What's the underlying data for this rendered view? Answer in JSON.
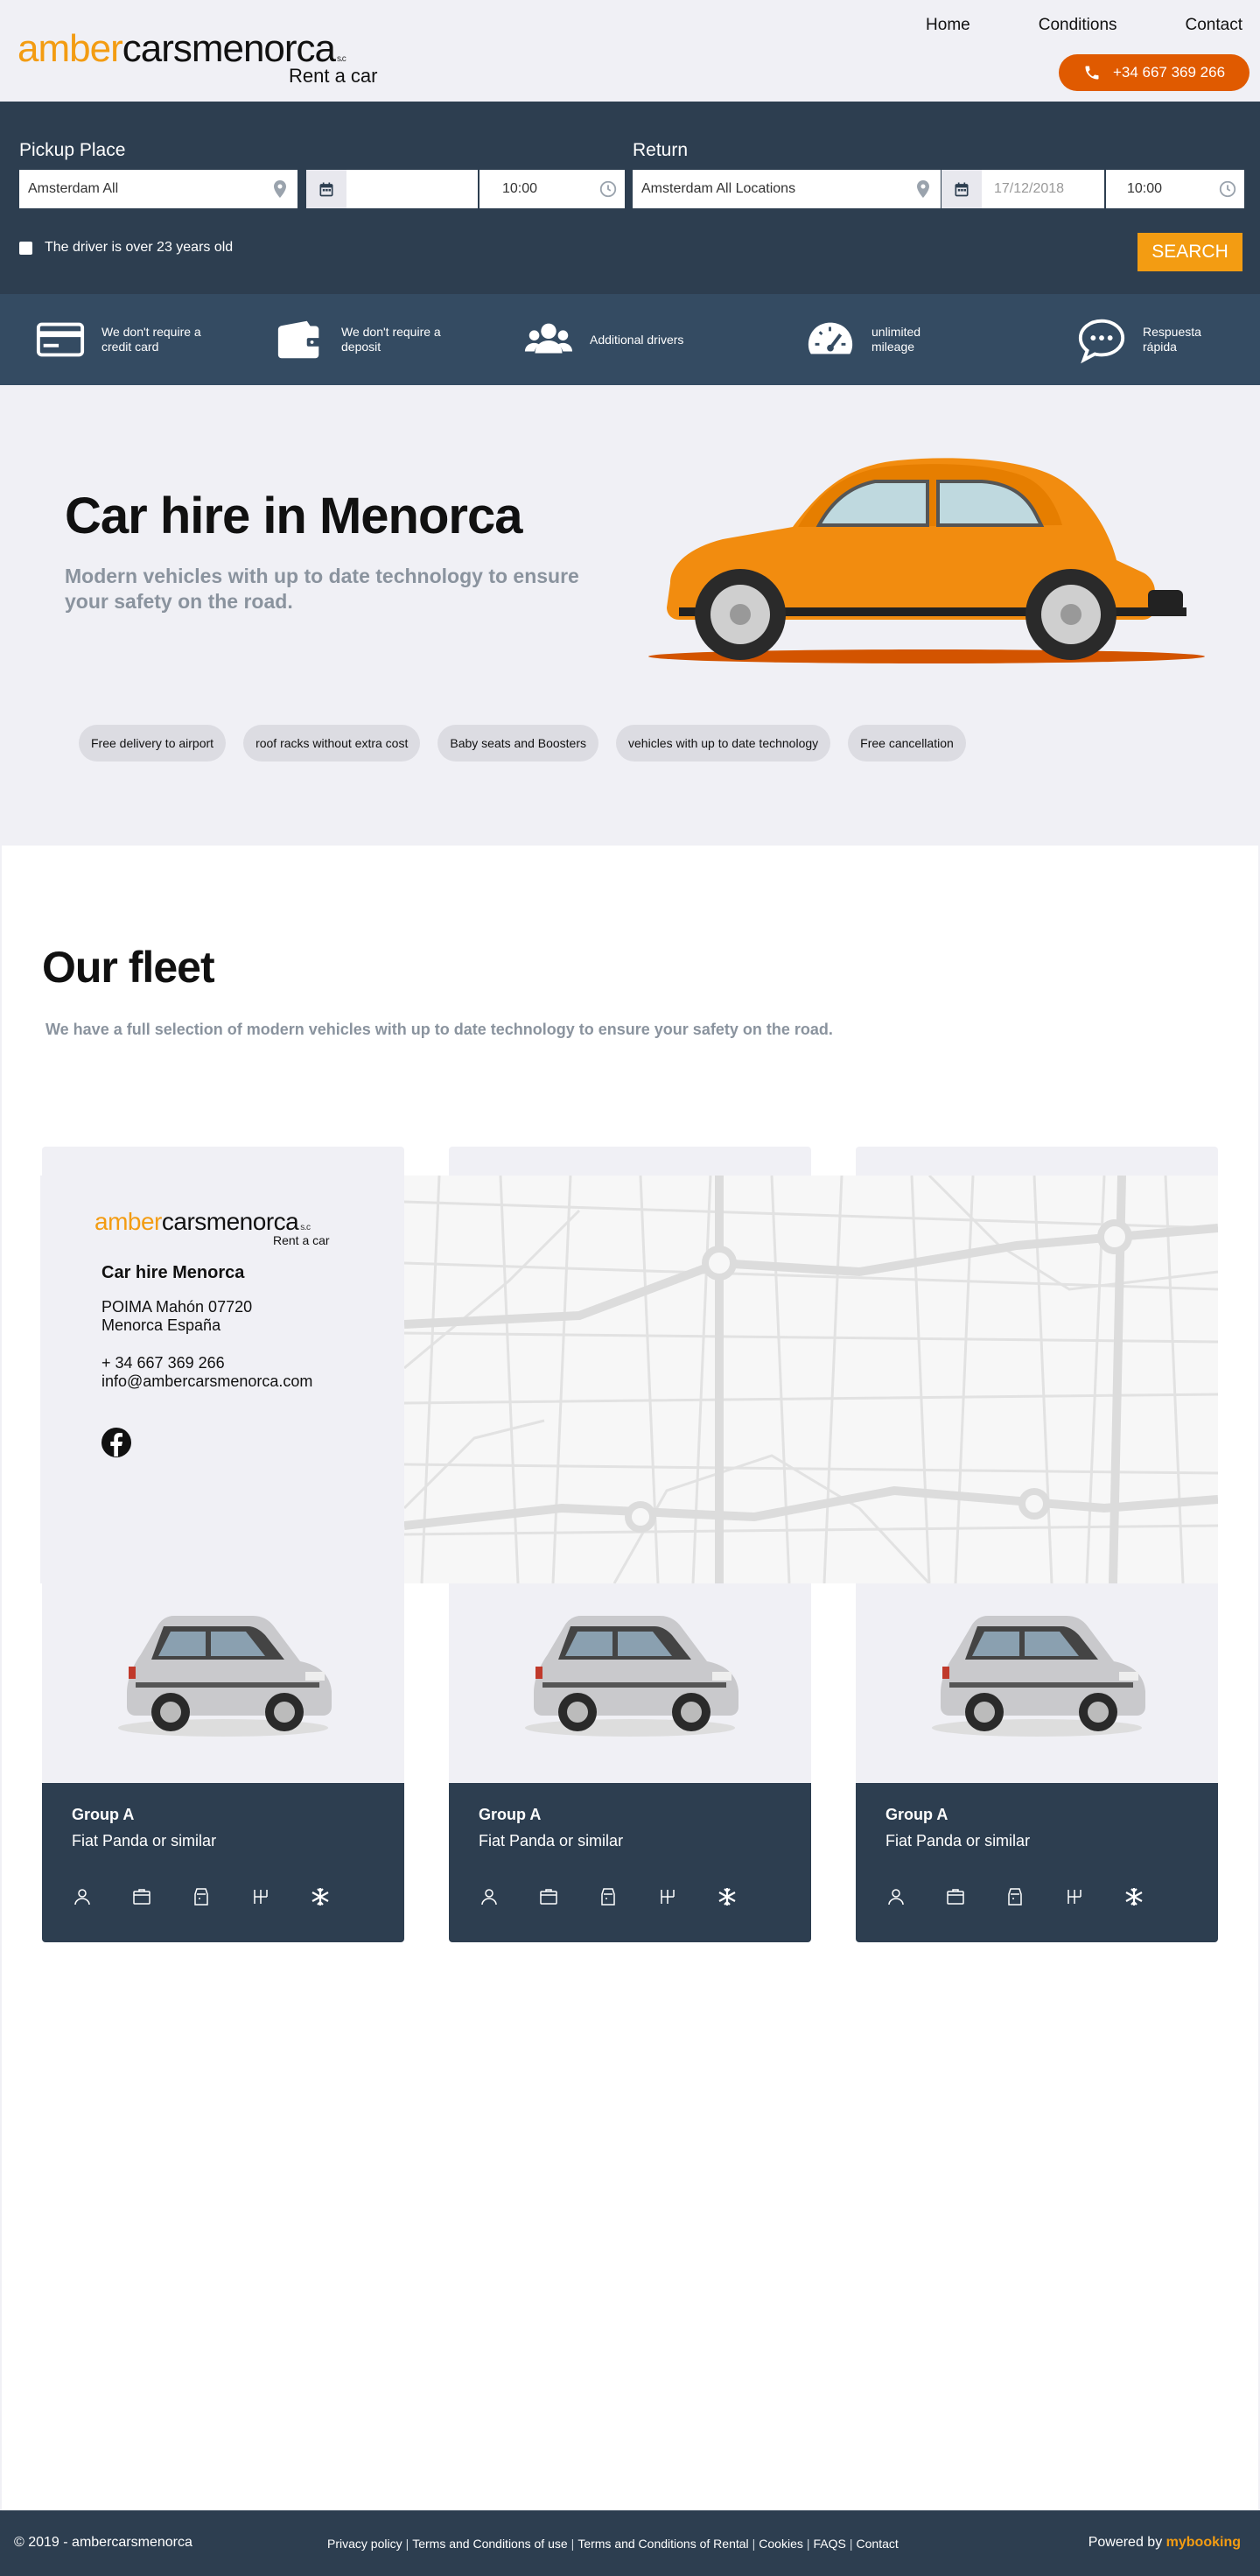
{
  "header": {
    "logo_amber": "amber",
    "logo_rest": "carsmenorca",
    "logo_sl": "s.c",
    "logo_sub": "Rent a car",
    "nav": [
      "Home",
      "Conditions",
      "Contact"
    ],
    "phone": "+34 667 369 266",
    "accent": "#f39c12",
    "phone_color": "#e05a00"
  },
  "search": {
    "pickup_label": "Pickup Place",
    "return_label": "Return",
    "pickup_place": "Amsterdam All",
    "pickup_date": "",
    "pickup_time": "10:00",
    "return_place": "Amsterdam All Locations",
    "return_date_placeholder": "17/12/2018",
    "return_time": "10:00",
    "driver_check": "The driver is over 23 years old",
    "search_button": "SEARCH",
    "bar_color": "#2d3e50"
  },
  "features": [
    {
      "icon": "credit-card-icon",
      "text": "We don't require a credit card"
    },
    {
      "icon": "wallet-icon",
      "text": "We don't require a deposit"
    },
    {
      "icon": "users-icon",
      "text": "Additional drivers"
    },
    {
      "icon": "speedometer-icon",
      "text": "unlimited mileage"
    },
    {
      "icon": "chat-icon",
      "text": "Respuesta rápida"
    }
  ],
  "hero": {
    "title": "Car hire in Menorca",
    "subtitle": "Modern vehicles with up to date technology to ensure your safety on the road.",
    "pills": [
      "Free delivery to airport",
      "roof racks without extra cost",
      "Baby seats and Boosters",
      "vehicles with up to date technology",
      "Free cancellation"
    ]
  },
  "fleet": {
    "title": "Our fleet",
    "subtitle": "We have a full selection of modern vehicles with up to date technology to ensure your safety on the road.",
    "cars": [
      {
        "group": "Group A",
        "model": "Fiat Panda or similar"
      },
      {
        "group": "Group A",
        "model": "Fiat Panda or similar"
      },
      {
        "group": "Group A",
        "model": "Fiat Panda or similar"
      },
      {
        "group": "Group A",
        "model": "Fiat Panda or similar"
      },
      {
        "group": "Group A",
        "model": "Fiat Panda or similar"
      },
      {
        "group": "Group A",
        "model": "Fiat Panda or similar"
      }
    ],
    "car_icons": [
      "person-icon",
      "suitcase-icon",
      "car-door-icon",
      "gearbox-icon",
      "air-conditioning-icon"
    ]
  },
  "contact": {
    "logo_amber": "amber",
    "logo_rest": "carsmenorca",
    "logo_sl": "s.c",
    "logo_sub": "Rent a car",
    "name": "Car hire Menorca",
    "address_1": "POIMA Mahón 07720",
    "address_2": "Menorca España",
    "phone": "+ 34 667 369 266",
    "email": "info@ambercarsmenorca.com"
  },
  "footer": {
    "copyright": "© 2019 - ambercarsmenorca",
    "links": [
      "Privacy policy",
      "Terms and Conditions of use",
      "Terms and Conditions of Rental",
      "Cookies",
      "FAQS",
      "Contact"
    ],
    "powered_by": "Powered by",
    "powered_brand": "mybooking"
  }
}
